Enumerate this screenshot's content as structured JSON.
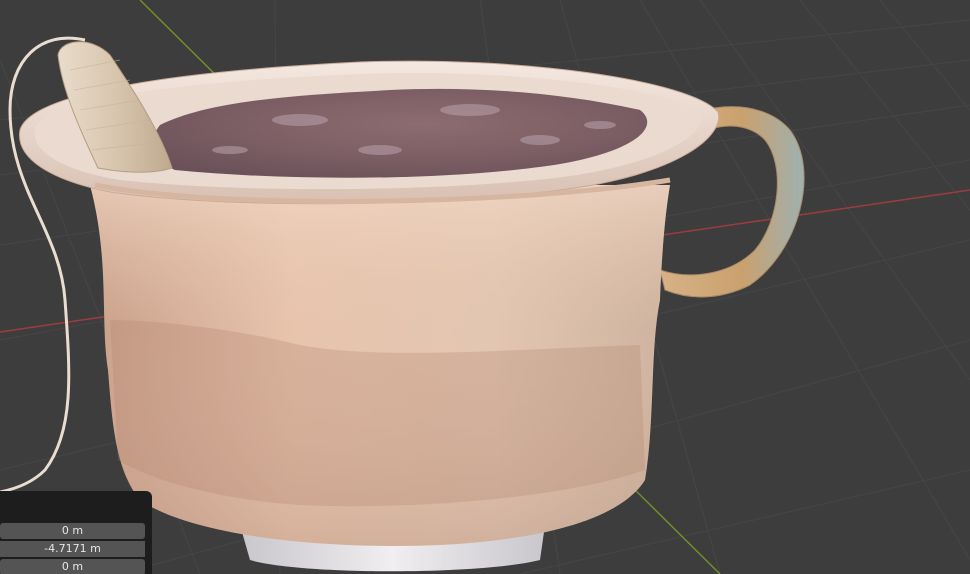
{
  "viewport": {
    "background": "#3d3d3d",
    "grid_color": "#454545",
    "x_axis_color": "#9c3c40",
    "y_axis_color": "#6f8f2a"
  },
  "transform_panel": {
    "fields": [
      {
        "value": "0 m"
      },
      {
        "value": "-4.7171 m"
      },
      {
        "value": "0 m"
      }
    ]
  }
}
